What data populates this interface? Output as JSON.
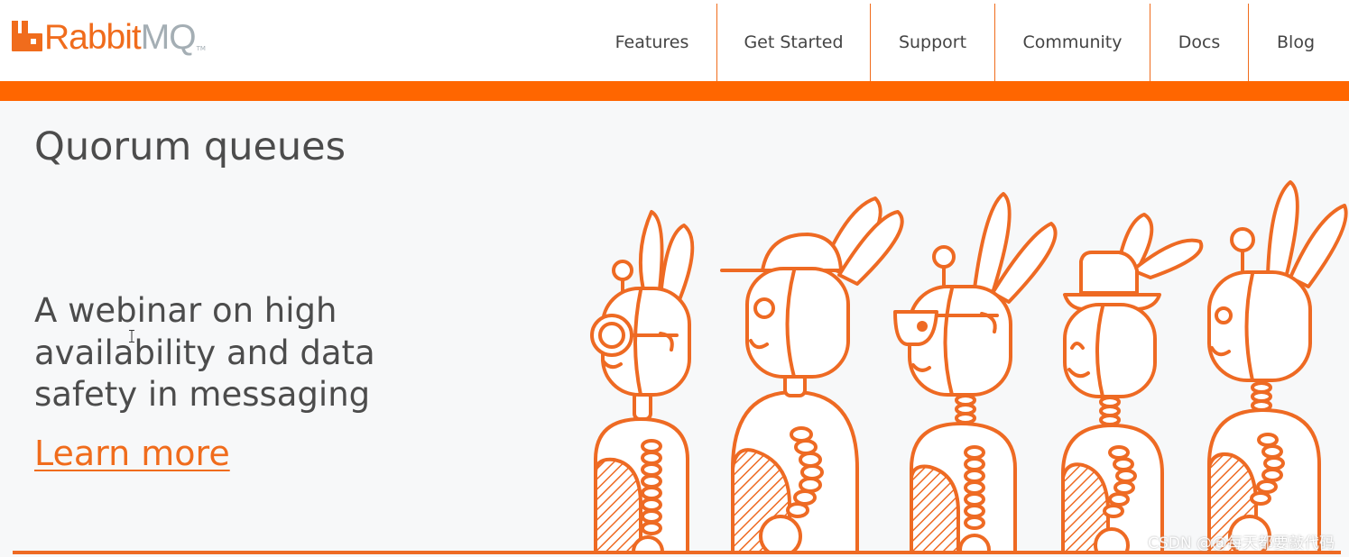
{
  "brand": {
    "name_part1": "Rabbit",
    "name_part2": "MQ",
    "trademark": "TM",
    "accent_color": "#ff6600",
    "grey_color": "#a4aeb4",
    "icon": "rabbitmq-logo-icon"
  },
  "nav": {
    "items": [
      {
        "label": "Features"
      },
      {
        "label": "Get Started"
      },
      {
        "label": "Support"
      },
      {
        "label": "Community"
      },
      {
        "label": "Docs"
      },
      {
        "label": "Blog"
      }
    ]
  },
  "hero": {
    "title": "Quorum queues",
    "subtitle_lines": [
      "A webinar on high",
      "availability and data",
      "safety in messaging"
    ],
    "cta_label": "Learn more",
    "illustration": "rabbit-robots-illustration",
    "background_color": "#f7f8f9",
    "link_color": "#f06c1c"
  },
  "watermark": {
    "text": "CSDN @@每天都要敲代码"
  }
}
